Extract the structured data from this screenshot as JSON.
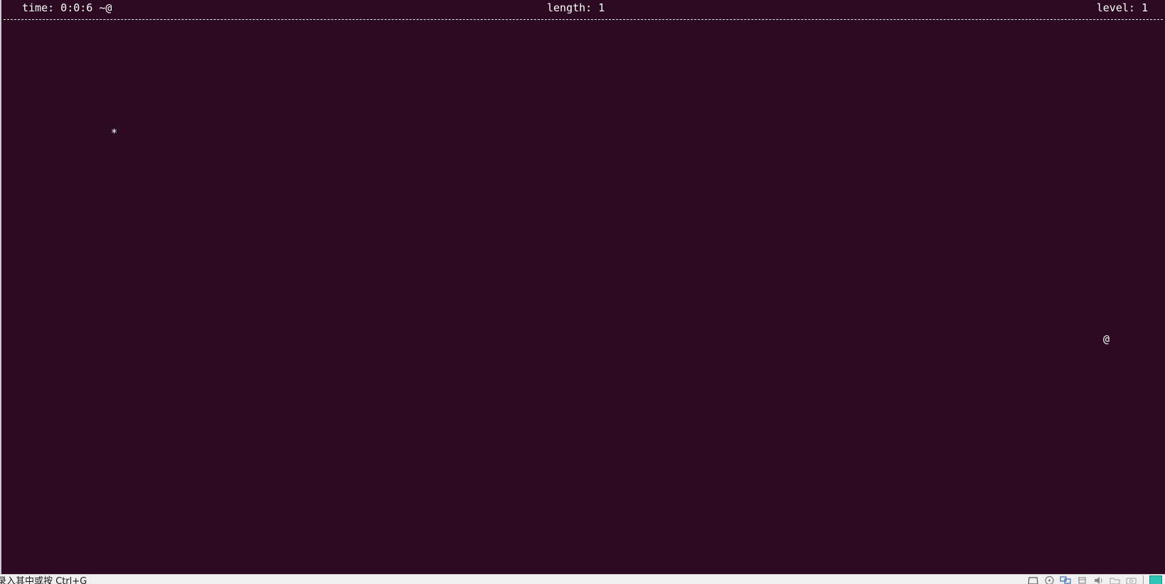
{
  "status": {
    "time_text": "time: 0:0:6 ~@",
    "length_text": "length: 1",
    "level_text": "level: 1"
  },
  "game": {
    "food_char": "*",
    "snake_head_char": "@"
  },
  "host_statusbar": {
    "hint_text": "录入其中或按 Ctrl+G",
    "tray_icons": [
      "hard-disk-icon",
      "optical-drive-icon",
      "network-icon",
      "usb-icon",
      "audio-icon",
      "shared-folder-icon",
      "capture-icon"
    ],
    "host_key_color": "#2ec4b6"
  },
  "colors": {
    "terminal_bg": "#2c0b22",
    "terminal_fg": "#ffffff"
  }
}
